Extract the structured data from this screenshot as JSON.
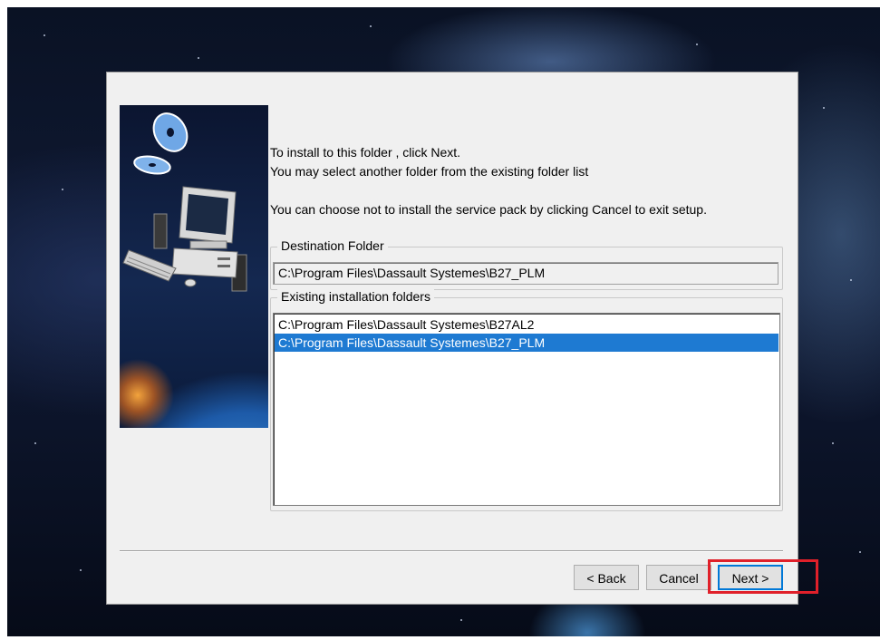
{
  "messages": {
    "line1": "To install to this folder , click Next.",
    "line2": "You may select another folder from the existing folder list",
    "line3": "You can choose not to install the service pack by clicking Cancel to exit setup."
  },
  "destination": {
    "label": "Destination Folder",
    "value": "C:\\Program Files\\Dassault Systemes\\B27_PLM"
  },
  "existing": {
    "label": "Existing installation folders",
    "items": [
      {
        "text": "C:\\Program Files\\Dassault Systemes\\B27AL2",
        "selected": false
      },
      {
        "text": "C:\\Program Files\\Dassault Systemes\\B27_PLM",
        "selected": true
      }
    ]
  },
  "buttons": {
    "back": "< Back",
    "cancel": "Cancel",
    "next": "Next >"
  },
  "colors": {
    "selection": "#1e7ad2",
    "highlight_box": "#e0202a"
  }
}
